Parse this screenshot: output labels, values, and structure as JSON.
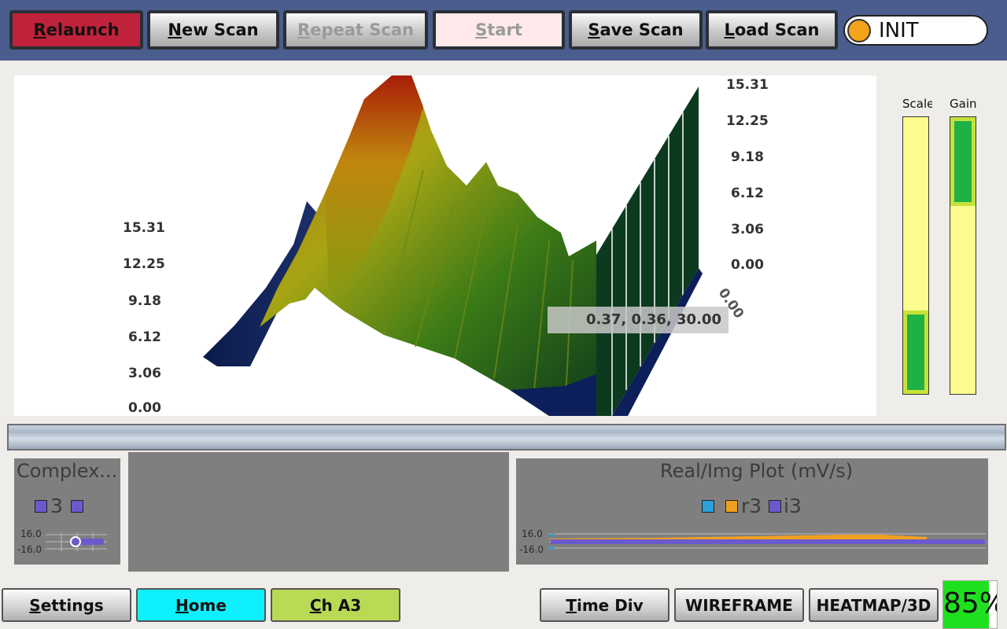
{
  "toolbar": {
    "relaunch": {
      "key": "R",
      "rest": "elaunch"
    },
    "new_scan": {
      "key": "N",
      "rest": "ew Scan"
    },
    "repeat_scan": {
      "key": "R",
      "rest": "epeat Scan"
    },
    "start": {
      "key": "S",
      "rest": "tart"
    },
    "save_scan": {
      "key": "S",
      "rest": "ave Scan"
    },
    "load_scan": {
      "key": "L",
      "rest": "oad Scan"
    },
    "status_text": "INIT"
  },
  "plot3d": {
    "right_axis": [
      "15.31",
      "12.25",
      "9.18",
      "6.12",
      "3.06",
      "0.00"
    ],
    "left_axis": [
      "15.31",
      "12.25",
      "9.18",
      "6.12",
      "3.06",
      "0.00"
    ],
    "depth_label": "0.00",
    "cursor_readout": "0.37, 0.36, 30.00"
  },
  "meters": {
    "scale_title": "Scale",
    "gain_title": "Gain",
    "scale_level": 0.3,
    "gain_level": 0.32
  },
  "complex_panel": {
    "title": "Complex...",
    "legend_label": "3",
    "tick_top": "16.0",
    "tick_bottom": "-16.0",
    "series_color": "#6a5acd"
  },
  "realimg_panel": {
    "title": "Real/Img Plot (mV/s)",
    "legend": [
      {
        "label": "",
        "color": "#2aa0d8"
      },
      {
        "label": "r3",
        "color": "#f0a020"
      },
      {
        "label": "i3",
        "color": "#6a5acd"
      }
    ],
    "tick_top": "16.0",
    "tick_bottom": "-16.0"
  },
  "bottom": {
    "settings": {
      "key": "S",
      "rest": "ettings"
    },
    "home": {
      "key": "H",
      "rest": "ome"
    },
    "channel": {
      "key": "C",
      "rest": "h A3"
    },
    "time_div": {
      "key": "T",
      "rest": "ime Div"
    },
    "wireframe": "WIREFRAME",
    "heatmap": "HEATMAP/3D",
    "percent_text": "85%",
    "percent_value": 0.85
  },
  "colors": {
    "toolbar_bg": "#4a5d8c",
    "relaunch_red": "#c0223b",
    "home_cyan": "#0ff0ff",
    "channel_green": "#b9da55",
    "status_orange": "#f5a31a"
  }
}
